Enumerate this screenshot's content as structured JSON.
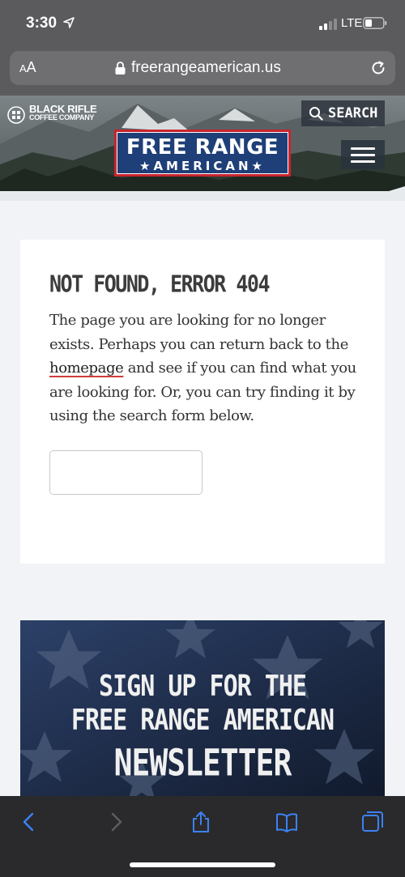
{
  "status_bar": {
    "time": "3:30",
    "network": "LTE"
  },
  "browser": {
    "text_size_label": "AA",
    "url": "freerangeamerican.us"
  },
  "site_header": {
    "partner_brand_line1": "BLACK RIFLE",
    "partner_brand_line2": "COFFEE COMPANY",
    "search_label": "SEARCH",
    "logo_top": "FREE RANGE",
    "logo_bottom": "★AMERICAN★"
  },
  "error_card": {
    "title": "NOT FOUND, ERROR 404",
    "body_before_link": "The page you are looking for no longer exists. Perhaps you can return back to the ",
    "link_text": "homepage",
    "body_after_link": " and see if you can find what you are looking for. Or, you can try finding it by using the search form below.",
    "search_placeholder": ""
  },
  "newsletter": {
    "line1": "SIGN UP FOR THE",
    "line2": "FREE RANGE AMERICAN",
    "line3": "NEWSLETTER"
  },
  "colors": {
    "accent_blue": "#1f3f78",
    "accent_red": "#c8242e",
    "ios_link_blue": "#3b82f6"
  }
}
